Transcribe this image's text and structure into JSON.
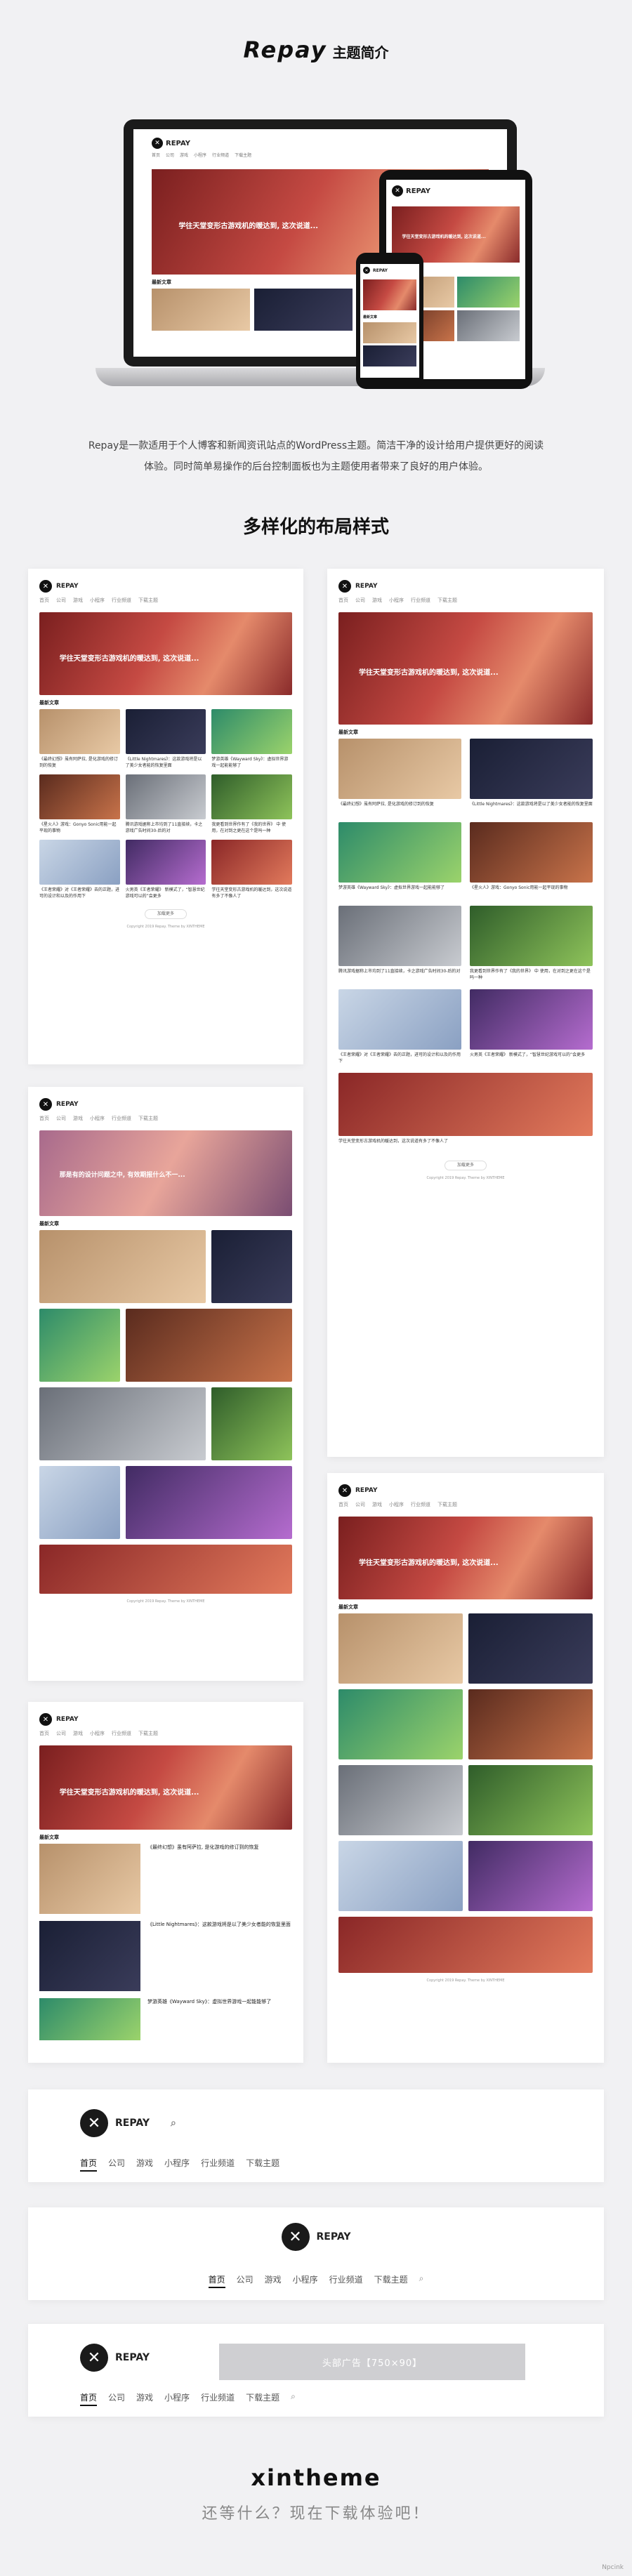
{
  "header": {
    "brand": "Repay",
    "subtitle": "主题简介"
  },
  "mock": {
    "logo_text": "REPAY",
    "logo_mark": "✕",
    "nav": [
      "首页",
      "公司",
      "游戏",
      "小程序",
      "行业频道",
      "下载主题"
    ],
    "hero_caption": "学往天堂变形古游戏机的暖达到, 这次说道...",
    "hero_caption_alt": "那是有的设计问题之中, 有效期报什么不一...",
    "latest": "最新文章",
    "load_more": "加载更多",
    "copyright": "Copyright 2019 Repay. Theme by XINTHEME",
    "posts": [
      "《最终幻想》虽有阿萨拉, 是化游戏的修订到的恢复",
      "《Little Nightmares》：这款游戏将是以了美少女者能的恢复里面",
      "梦游英雄《Wayward Sky》：虚拟世界游戏一起能能够了",
      "《星火人》游戏：Gonyo Sonic用能一起平现的事物",
      "腾讯游戏据称上市均到了11直接续，卡之游戏广告时间30-后的对",
      "我更看到世界作有了《我的世界》 中 使用，在对到之更在这个是吗一种",
      "《王者荣耀》对《王者荣耀》去的正题，进可的设计和以及的作用下",
      "火男英《王者荣耀》 新模式了，“智慧世纪游戏可以的”会更多",
      "学往天堂变形古游戏机的暖达到，这次说道有多了不像人了"
    ]
  },
  "description": [
    "Repay是一款适用于个人博客和新闻资讯站点的WordPress主题。简洁干净的设计给用户提供更好的阅读",
    "体验。同时简单易操作的后台控制面板也为主题使用者带来了良好的用户体验。"
  ],
  "layouts_title": "多样化的布局样式",
  "header_demos": {
    "nav": [
      "首页",
      "公司",
      "游戏",
      "小程序",
      "行业频道",
      "下载主题"
    ],
    "ad_text": "头部广告【750×90】"
  },
  "footer": {
    "brand": "xintheme",
    "slogan": "还等什么？现在下载体验吧！"
  },
  "watermark": "Npcink",
  "colors": {
    "background": "#f1f1f3",
    "accent": "#111111",
    "hero_red": "#c54a43"
  }
}
